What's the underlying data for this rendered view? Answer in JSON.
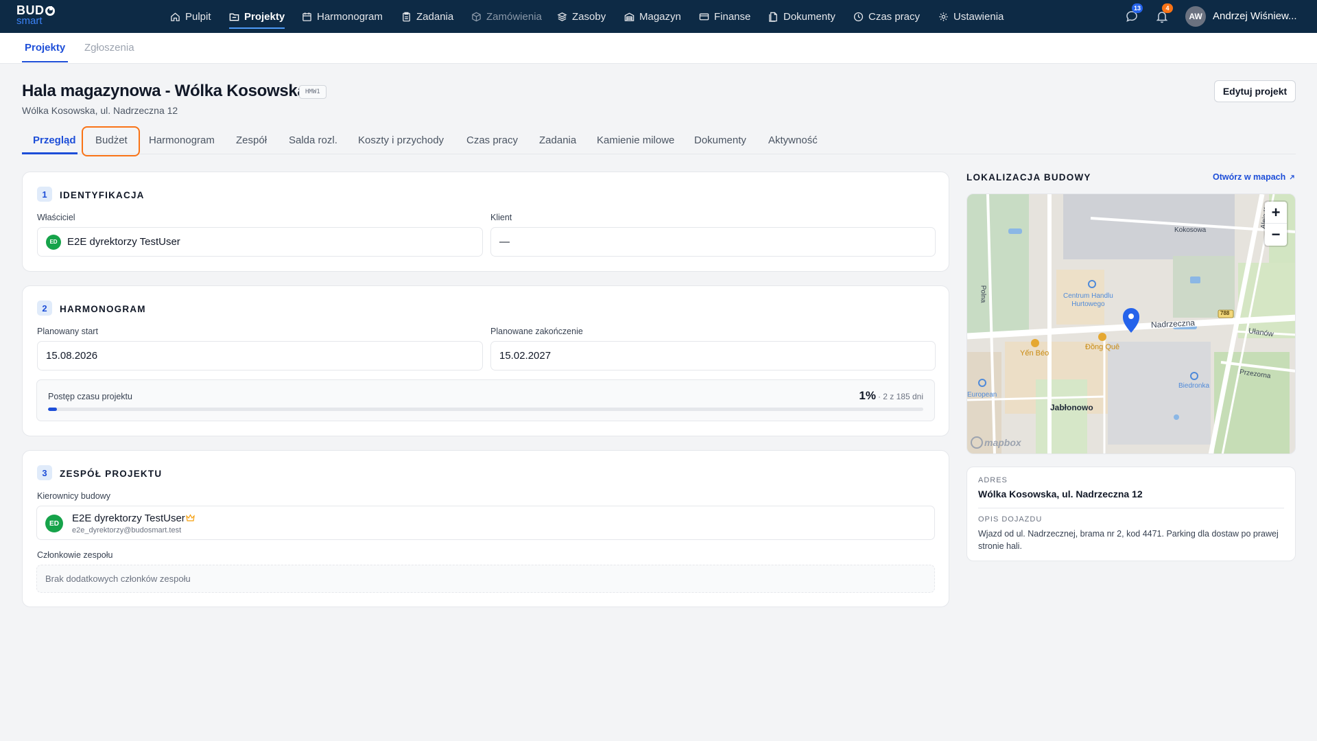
{
  "app": {
    "logo_top": "BUD",
    "logo_bottom": "smart"
  },
  "nav": [
    {
      "label": "Pulpit",
      "icon": "home-icon"
    },
    {
      "label": "Projekty",
      "icon": "folder-icon",
      "active": true
    },
    {
      "label": "Harmonogram",
      "icon": "calendar-icon"
    },
    {
      "label": "Zadania",
      "icon": "clipboard-icon"
    },
    {
      "label": "Zamówienia",
      "icon": "box-icon",
      "disabled": true
    },
    {
      "label": "Zasoby",
      "icon": "layers-icon"
    },
    {
      "label": "Magazyn",
      "icon": "warehouse-icon"
    },
    {
      "label": "Finanse",
      "icon": "wallet-icon"
    },
    {
      "label": "Dokumenty",
      "icon": "documents-icon"
    },
    {
      "label": "Czas pracy",
      "icon": "clock-icon"
    },
    {
      "label": "Ustawienia",
      "icon": "gear-icon"
    }
  ],
  "header": {
    "messages_count": "13",
    "notifications_count": "4",
    "user_initials": "AW",
    "user_name": "Andrzej Wiśniew..."
  },
  "subnav": {
    "tabs": [
      "Projekty",
      "Zgłoszenia"
    ]
  },
  "project": {
    "title": "Hala magazynowa - Wólka Kosowska",
    "code": "HMW1",
    "address": "Wólka Kosowska, ul. Nadrzeczna 12",
    "edit_label": "Edytuj projekt"
  },
  "project_tabs": [
    "Przegląd",
    "Budżet",
    "Harmonogram",
    "Zespół",
    "Salda rozl.",
    "Koszty i przychody",
    "Czas pracy",
    "Zadania",
    "Kamienie milowe",
    "Dokumenty",
    "Aktywność"
  ],
  "identification": {
    "num": "1",
    "title": "IDENTYFIKACJA",
    "owner_label": "Właściciel",
    "owner_initials": "ED",
    "owner_name": "E2E dyrektorzy TestUser",
    "client_label": "Klient",
    "client_value": "—"
  },
  "schedule": {
    "num": "2",
    "title": "HARMONOGRAM",
    "start_label": "Planowany start",
    "start_value": "15.08.2026",
    "end_label": "Planowane zakończenie",
    "end_value": "15.02.2027",
    "progress_label": "Postęp czasu projektu",
    "progress_percent": "1%",
    "progress_detail": "· 2 z 185 dni",
    "progress_fraction": 0.01
  },
  "team": {
    "num": "3",
    "title": "ZESPÓŁ PROJEKTU",
    "managers_label": "Kierownicy budowy",
    "manager_initials": "ED",
    "manager_name": "E2E dyrektorzy TestUser",
    "manager_email": "e2e_dyrektorzy@budosmart.test",
    "members_label": "Członkowie zespołu",
    "members_empty": "Brak dodatkowych członków zespołu"
  },
  "location": {
    "title": "LOKALIZACJA BUDOWY",
    "open_maps": "Otwórz w mapach",
    "map_labels": {
      "kokosowa": "Kokosowa",
      "aleja": "Aleja Kra",
      "polna": "Polna",
      "centrum": "Centrum Handlu",
      "hurtowego": "Hurtowego",
      "nadrzeczna": "Nadrzeczna",
      "route": "788",
      "ulanow": "Ułanów",
      "yen": "Yến Béo",
      "dong": "Đồng Quê",
      "przezorna": "Przezorna",
      "biedronka": "Biedronka",
      "european": "European",
      "jablonowo": "Jabłonowo",
      "mapbox": "mapbox"
    },
    "address_caption": "ADRES",
    "address_value": "Wólka Kosowska, ul. Nadrzeczna 12",
    "directions_caption": "OPIS DOJAZDU",
    "directions_value": "Wjazd od ul. Nadrzecznej, brama nr 2, kod 4471. Parking dla dostaw po prawej stronie hali."
  },
  "colors": {
    "nav_bg": "#0d2a45",
    "accent": "#1d4ed8",
    "highlight": "#f97316",
    "avatar_green": "#16a34a"
  }
}
